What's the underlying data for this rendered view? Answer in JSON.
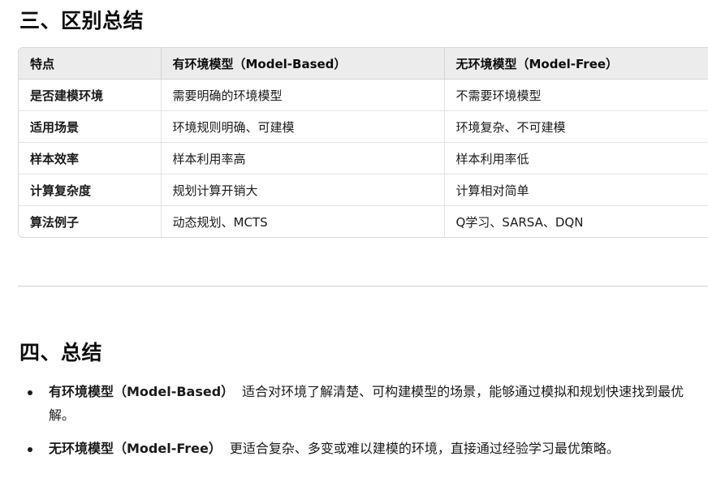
{
  "section3": {
    "title": "三、区别总结"
  },
  "table": {
    "headers": [
      "特点",
      "有环境模型（Model-Based）",
      "无环境模型（Model-Free）"
    ],
    "rows": [
      [
        "是否建模环境",
        "需要明确的环境模型",
        "不需要环境模型"
      ],
      [
        "适用场景",
        "环境规则明确、可建模",
        "环境复杂、不可建模"
      ],
      [
        "样本效率",
        "样本利用率高",
        "样本利用率低"
      ],
      [
        "计算复杂度",
        "规划计算开销大",
        "计算相对简单"
      ],
      [
        "算法例子",
        "动态规划、MCTS",
        "Q学习、SARSA、DQN"
      ]
    ]
  },
  "section4": {
    "title": "四、总结",
    "bullets": [
      {
        "strong": "有环境模型（Model-Based）",
        "text": "适合对环境了解清楚、可构建模型的场景，能够通过模拟和规划快速找到最优解。"
      },
      {
        "strong": "无环境模型（Model-Free）",
        "text": "更适合复杂、多变或难以建模的环境，直接通过经验学习最优策略。"
      }
    ]
  }
}
